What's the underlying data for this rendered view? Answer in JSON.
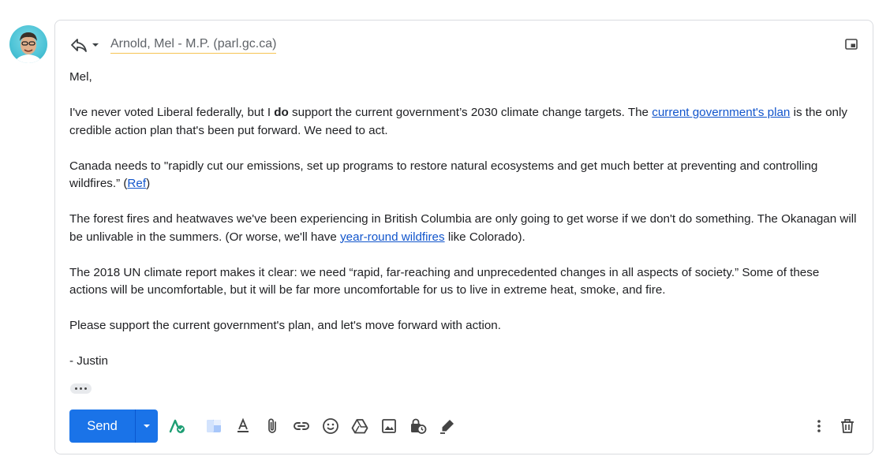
{
  "header": {
    "recipient": "Arnold, Mel - M.P. (parl.gc.ca)"
  },
  "body": {
    "greeting": "Mel,",
    "p1": {
      "before": "I've never voted Liberal federally, but I ",
      "bold": "do",
      "middle": " support the current government’s 2030 climate change targets. The ",
      "link": "current government's plan",
      "after": " is the only credible action plan that's been put forward. We need to act."
    },
    "p2": {
      "before": "Canada needs to \"rapidly cut our emissions, set up programs to restore natural ecosystems and get much better at preventing and controlling wildfires.” (",
      "link": "Ref",
      "after": ")"
    },
    "p3": {
      "before": "The forest fires and heatwaves we've been experiencing in British Columbia are only going to get worse if we don't do something. The Okanagan will be unlivable in the summers. (Or worse, we'll have ",
      "link": "year-round wildfires",
      "after": " like Colorado)."
    },
    "p4": "The 2018 UN climate report makes it clear: we need “rapid, far-reaching and unprecedented changes in all aspects of society.” Some of these actions will be uncomfortable, but it will be far more uncomfortable for us to live in extreme heat, smoke, and fire.",
    "p5": "Please support the current government's plan, and let's move forward with action.",
    "signature": "- Justin"
  },
  "toolbar": {
    "send_label": "Send",
    "icons": [
      "grammar-check-icon",
      "layout-template-icon",
      "text-format-icon",
      "attach-file-icon",
      "insert-link-icon",
      "emoji-icon",
      "google-drive-icon",
      "insert-photo-icon",
      "confidential-mode-icon",
      "signature-icon",
      "more-options-icon",
      "delete-icon"
    ]
  },
  "colors": {
    "send_button": "#1a73e8",
    "link": "#1155cc",
    "recipient_underline": "#f6c453",
    "grammar_check": "#1e9e74"
  }
}
